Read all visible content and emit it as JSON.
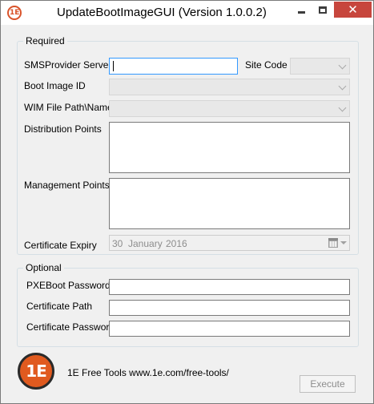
{
  "window": {
    "title": "UpdateBootImageGUI (Version 1.0.0.2)",
    "app_icon_text": "1E"
  },
  "required": {
    "group_label": "Required",
    "sms_provider_label": "SMSProvider Server",
    "sms_provider_value": "",
    "site_code_label": "Site Code",
    "site_code_value": "",
    "boot_image_label": "Boot Image ID",
    "boot_image_value": "",
    "wim_label": "WIM File Path\\Name",
    "wim_value": "",
    "distribution_points_label": "Distribution Points",
    "distribution_points_value": "",
    "management_points_label": "Management Points",
    "management_points_value": "",
    "certificate_expiry_label": "Certificate Expiry",
    "certificate_expiry": {
      "day": "30",
      "month": "January",
      "year": "2016"
    }
  },
  "optional": {
    "group_label": "Optional",
    "pxeboot_password_label": "PXEBoot Password",
    "pxeboot_password_value": "",
    "certificate_path_label": "Certificate Path",
    "certificate_path_value": "",
    "certificate_password_label": "Certificate Password",
    "certificate_password_value": ""
  },
  "footer": {
    "logo_text": "1E",
    "text": "1E Free Tools www.1e.com/free-tools/",
    "execute_label": "Execute"
  },
  "colors": {
    "close_button": "#c7463d",
    "logo": "#e05a1f",
    "focus_border": "#3399ff"
  }
}
